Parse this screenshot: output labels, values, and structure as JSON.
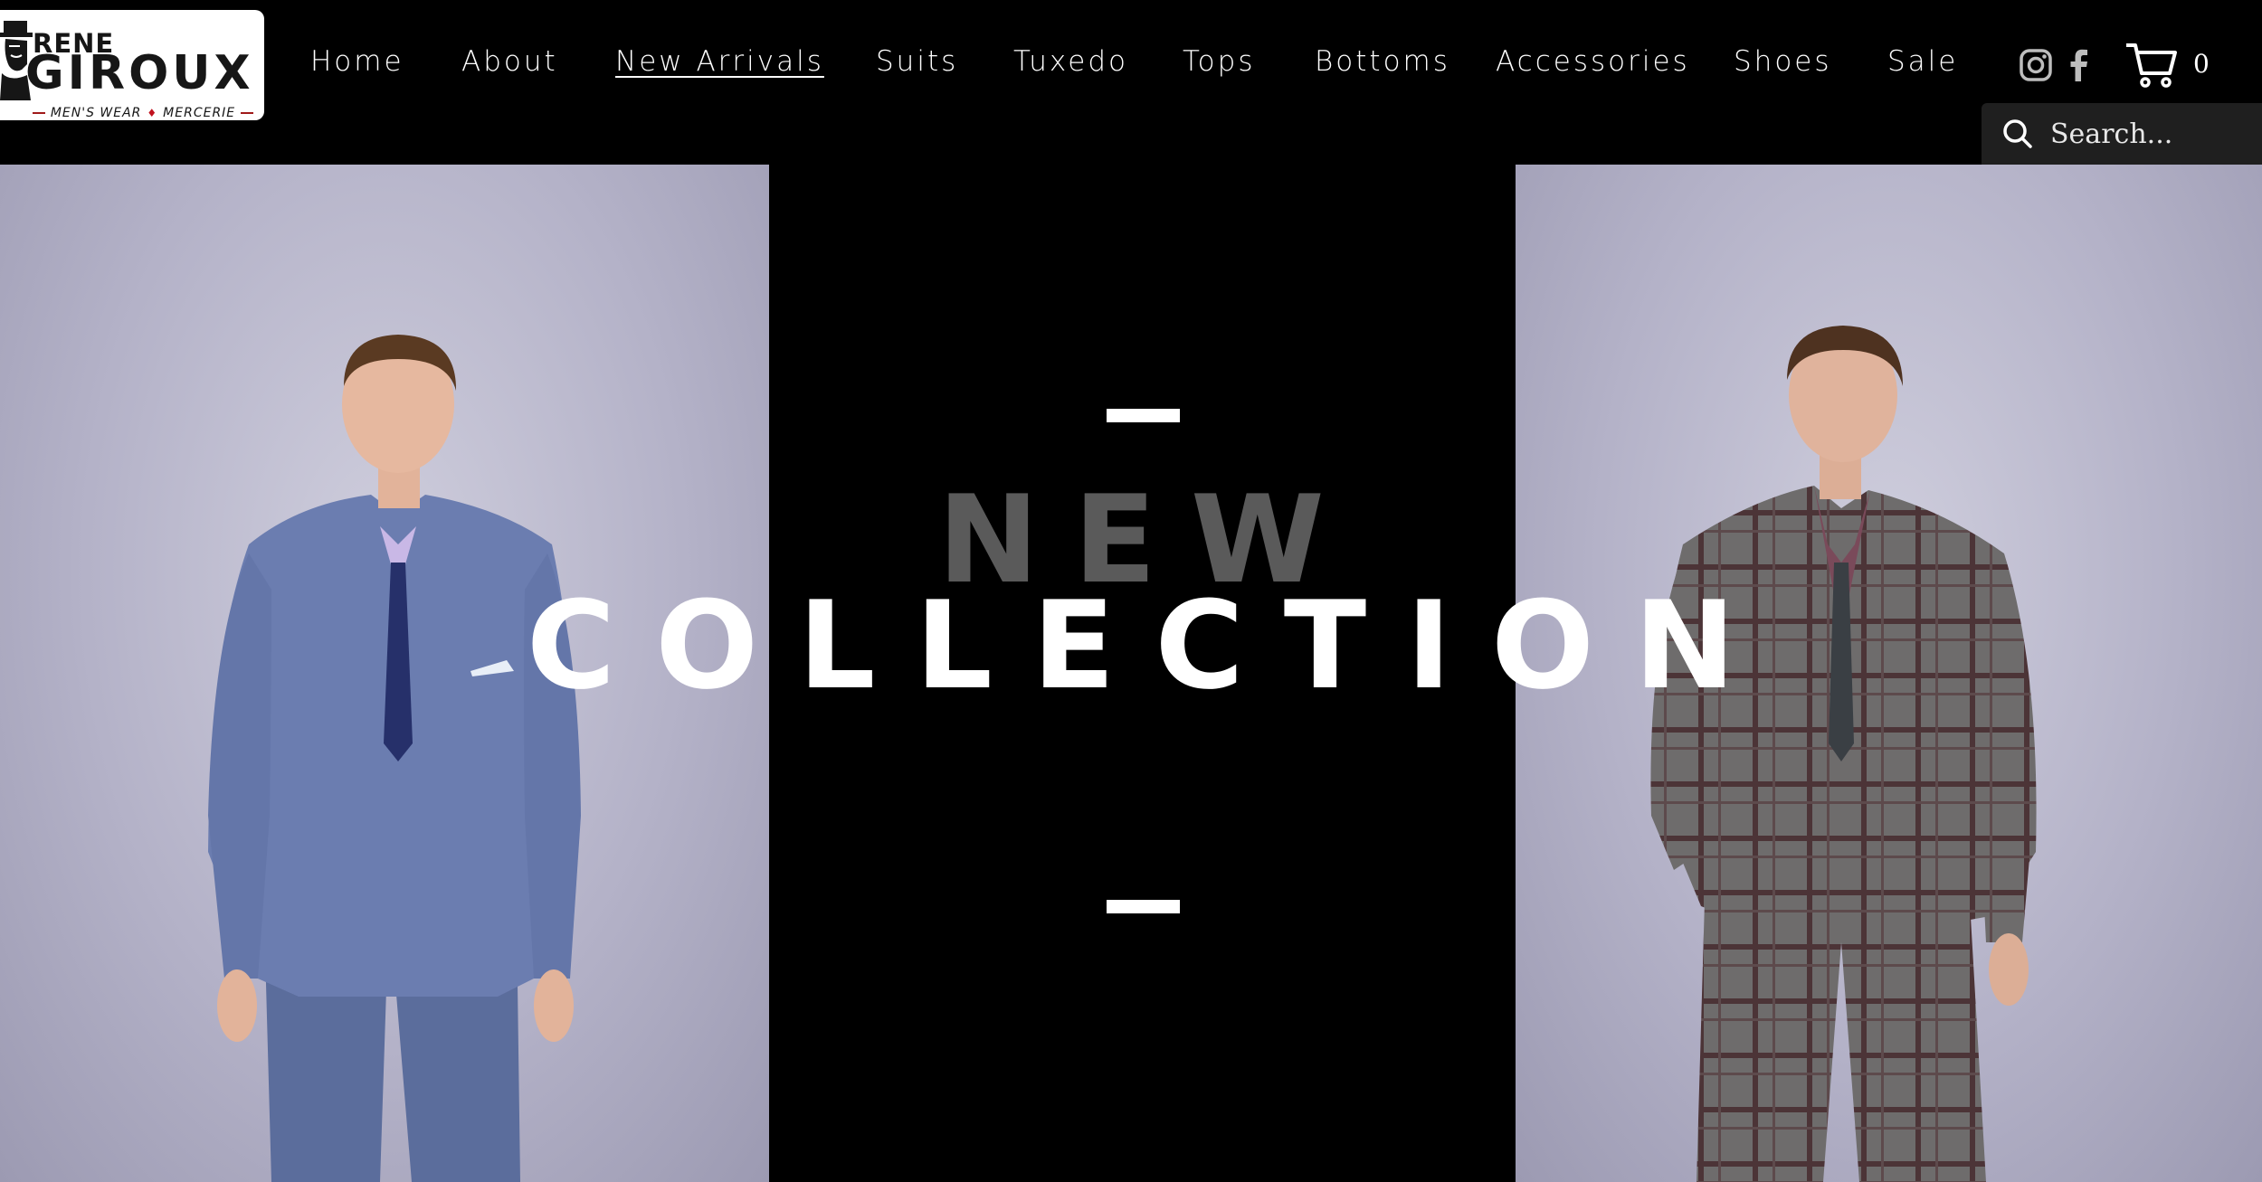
{
  "brand": {
    "name_line1": "RENE",
    "name_line2": "GIROUX",
    "tagline_left": "MEN'S WEAR",
    "tagline_right": "MERCERIE",
    "tagline_separator": "♦"
  },
  "nav": {
    "items": [
      {
        "label": "Home"
      },
      {
        "label": "About"
      },
      {
        "label": "New Arrivals",
        "active": true
      },
      {
        "label": "Suits"
      },
      {
        "label": "Tuxedo"
      },
      {
        "label": "Tops"
      },
      {
        "label": "Bottoms"
      },
      {
        "label": "Accessories"
      },
      {
        "label": "Shoes"
      },
      {
        "label": "Sale"
      }
    ]
  },
  "social": {
    "icons": [
      "instagram-icon",
      "facebook-icon"
    ]
  },
  "cart": {
    "count": "0",
    "icon": "cart-icon"
  },
  "search": {
    "placeholder": "Search...",
    "icon": "search-icon"
  },
  "hero": {
    "line1": "NEW",
    "line2": "COLLECTION"
  },
  "colors": {
    "background": "#000000",
    "accent_red": "#c1121f",
    "title_grey": "#5a5a5a",
    "text_white": "#ffffff"
  }
}
